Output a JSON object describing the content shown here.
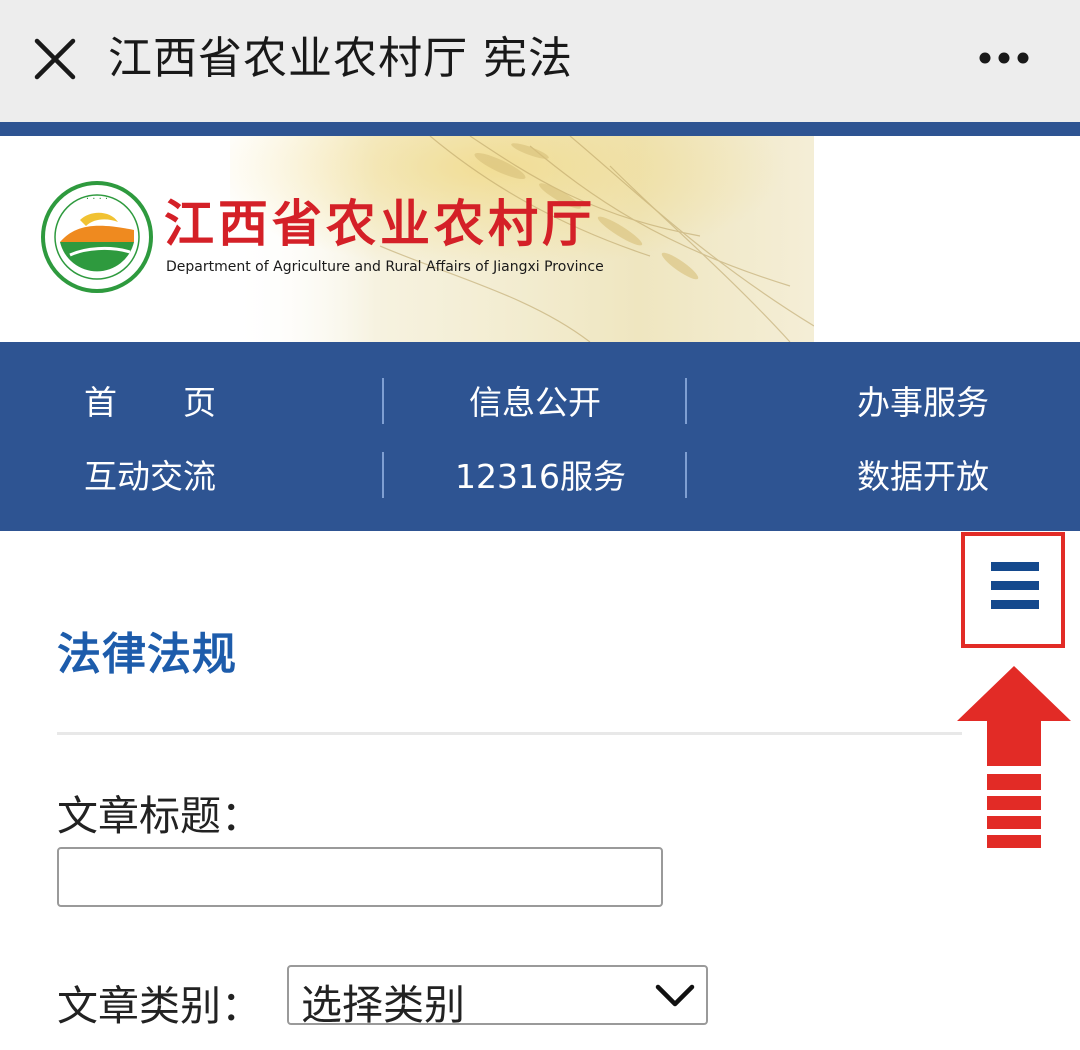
{
  "topbar": {
    "title": "江西省农业农村厅 宪法",
    "close_icon": "close-icon",
    "more_icon": "more-icon"
  },
  "banner": {
    "org_name_cn": "江西省农业农村厅",
    "org_name_en": "Department of Agriculture and Rural Affairs of Jiangxi Province",
    "logo_icon": "emblem-logo"
  },
  "nav": {
    "items": [
      {
        "label": "首　　页"
      },
      {
        "label": "信息公开"
      },
      {
        "label": "办事服务"
      },
      {
        "label": "互动交流"
      },
      {
        "label": "12316服务"
      },
      {
        "label": "数据开放"
      }
    ]
  },
  "content": {
    "section_title": "法律法规",
    "menu_icon": "hamburger-menu-icon",
    "arrow_icon": "red-up-arrow-icon",
    "title_label": "文章标题：",
    "title_value": "",
    "category_label": "文章类别：",
    "category_selected": "选择类别"
  },
  "colors": {
    "nav_bg": "#2e5492",
    "title_blue": "#1d5cab",
    "org_red": "#d42027",
    "highlight_red": "#e22b26"
  }
}
